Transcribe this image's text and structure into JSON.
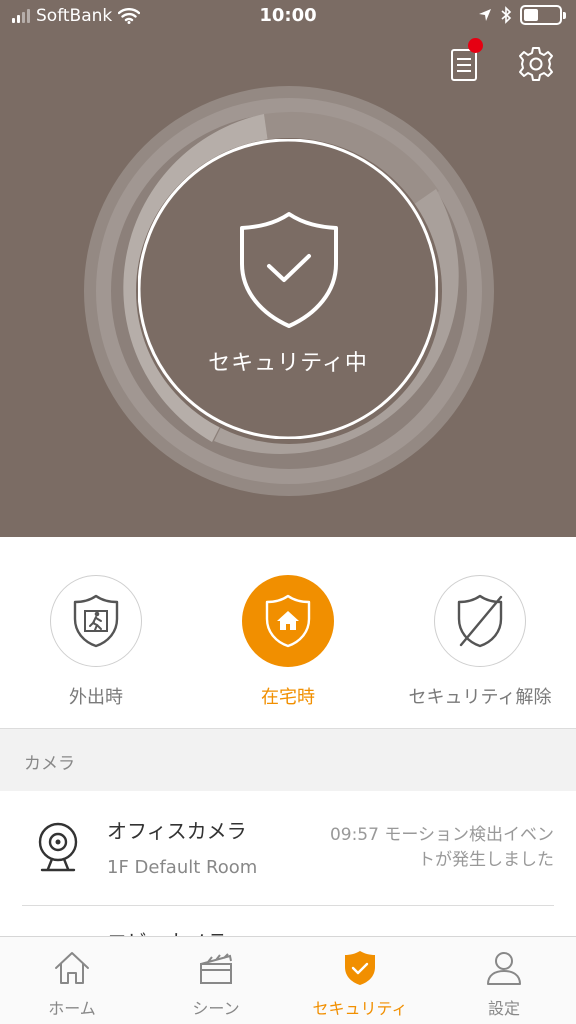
{
  "status_bar": {
    "carrier": "SoftBank",
    "time": "10:00"
  },
  "header": {
    "notification_badge_color": "#e60012"
  },
  "security": {
    "status_text": "セキュリティ中",
    "active_mode": "在宅時"
  },
  "modes": [
    {
      "label": "外出時",
      "icon": "away-shield-icon",
      "active": false
    },
    {
      "label": "在宅時",
      "icon": "home-shield-icon",
      "active": true
    },
    {
      "label": "セキュリティ解除",
      "icon": "disarm-shield-icon",
      "active": false
    }
  ],
  "camera_section": {
    "title": "カメラ",
    "items": [
      {
        "name": "オフィスカメラ",
        "room": "1F Default Room",
        "event_line1": "09:57 モーション検出イベン",
        "event_line2": "トが発生しました"
      },
      {
        "name": "ロビーカメラ"
      }
    ]
  },
  "tab_bar": {
    "tabs": [
      {
        "label": "ホーム",
        "icon": "home-icon",
        "active": false
      },
      {
        "label": "シーン",
        "icon": "clapperboard-icon",
        "active": false
      },
      {
        "label": "セキュリティ",
        "icon": "shield-check-icon",
        "active": true
      },
      {
        "label": "設定",
        "icon": "person-icon",
        "active": false
      }
    ]
  },
  "colors": {
    "hero_background": "#7b6c64",
    "accent": "#f18f00"
  }
}
